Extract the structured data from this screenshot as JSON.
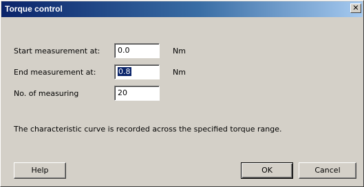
{
  "window": {
    "title": "Torque control",
    "close_symbol": "✕"
  },
  "fields": {
    "start": {
      "label": "Start measurement at:",
      "value": "0.0",
      "unit": "Nm"
    },
    "end": {
      "label": "End measurement at:",
      "value": "0.8",
      "unit": "Nm"
    },
    "count": {
      "label": "No. of measuring",
      "value": "20"
    }
  },
  "note": "The characteristic curve is recorded across the specified torque range.",
  "buttons": {
    "help": "Help",
    "ok": "OK",
    "cancel": "Cancel"
  }
}
